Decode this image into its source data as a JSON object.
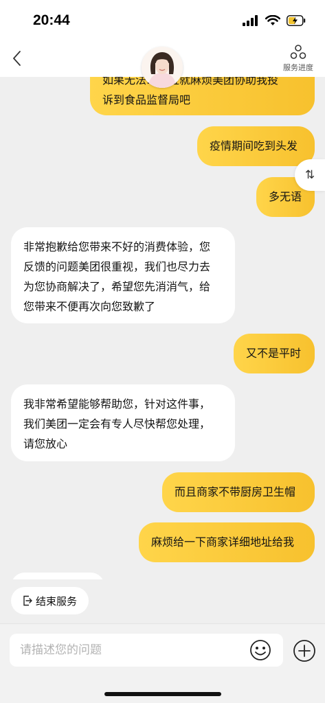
{
  "status_bar": {
    "time": "20:44"
  },
  "nav": {
    "service_progress_label": "服务进度"
  },
  "messages": [
    {
      "from": "me",
      "lines": [
        "如果无法……位就麻烦美团协助我投",
        "诉到食品监督局吧"
      ]
    },
    {
      "from": "me",
      "lines": [
        "疫情期间吃到头发"
      ]
    },
    {
      "from": "me",
      "lines": [
        "多无语"
      ]
    },
    {
      "from": "agent",
      "lines": [
        "非常抱歉给您带来不好的消费体验，您",
        "反馈的问题美团很重视，我们也尽力去",
        "为您协商解决了，希望您先消消气，给",
        "您带来不便再次向您致歉了"
      ]
    },
    {
      "from": "me",
      "lines": [
        "又不是平时"
      ]
    },
    {
      "from": "agent",
      "lines": [
        "我非常希望能够帮助您，针对这件事，",
        "我们美团一定会有专人尽快帮您处理，",
        "请您放心"
      ]
    },
    {
      "from": "me",
      "lines": [
        "而且商家不带厨房卫生帽"
      ]
    },
    {
      "from": "me",
      "lines": [
        "麻烦给一下商家详细地址给我"
      ]
    }
  ],
  "float_toggle": {
    "label": "⇅"
  },
  "end_service": {
    "label": "结束服务"
  },
  "input": {
    "placeholder": "请描述您的问题"
  },
  "colors": {
    "accent": "#FFD54A",
    "accent_dark": "#F7C12E",
    "background": "#EFEFEF"
  }
}
